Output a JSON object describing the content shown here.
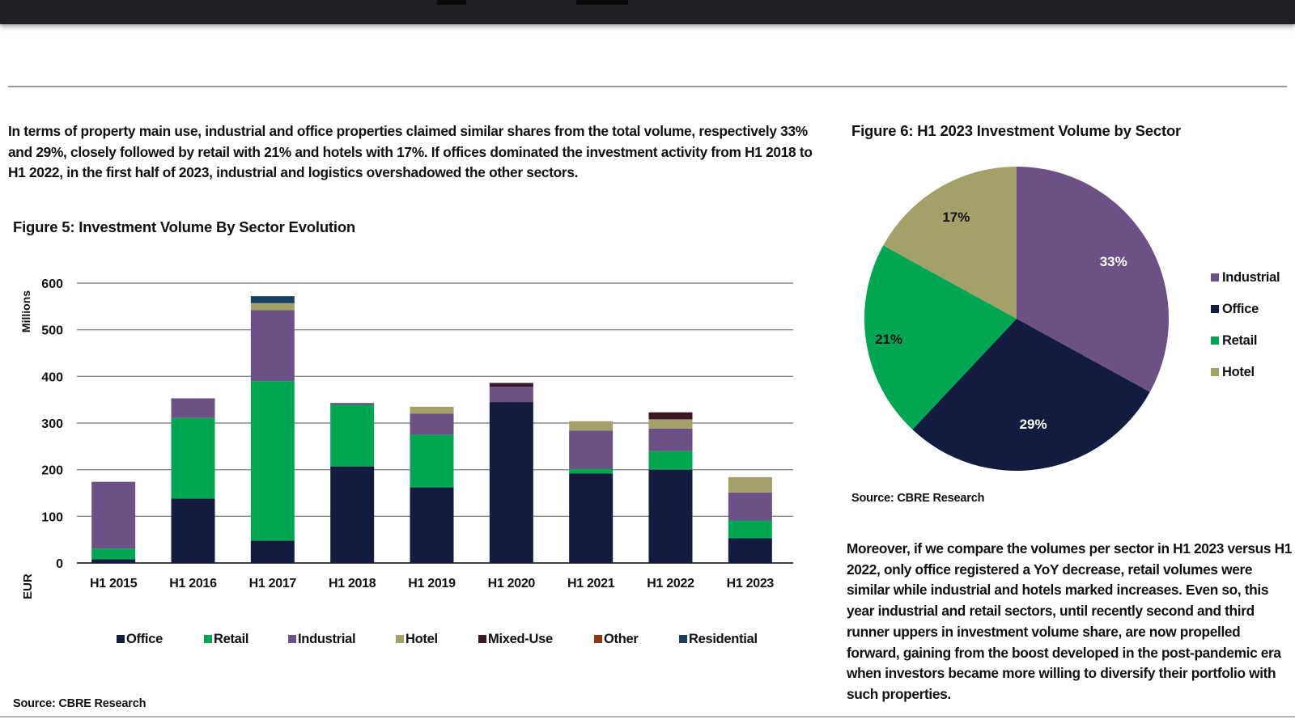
{
  "intro_text": "In terms of property main use, industrial and office properties claimed similar shares from the total volume, respectively 33% and 29%, closely followed by retail with 21% and hotels with 17%. If offices dominated the investment activity from H1 2018 to H1 2022, in the first half of 2023, industrial and logistics overshadowed the other sectors.",
  "body_text": "Moreover, if we compare the volumes per sector in H1 2023 versus H1 2022, only office registered a YoY decrease, retail volumes were similar while industrial and hotels marked increases. Even so, this year industrial and retail sectors, until recently second and third runner uppers in investment volume share, are now propelled forward, gaining from the boost developed in the post-pandemic era when investors became more willing to diversify their portfolio with such properties.",
  "colors": {
    "Office": "#131c3e",
    "Retail": "#00a651",
    "Industrial": "#6b5185",
    "Hotel": "#a3a06a",
    "Mixed-Use": "#3a1828",
    "Other": "#8a3a14",
    "Residential": "#17405f"
  },
  "chart_data": [
    {
      "type": "bar",
      "stacked": true,
      "title": "Figure 5: Investment Volume By Sector Evolution",
      "ylabel": "Millions",
      "ylabel2": "EUR",
      "ylim": [
        0,
        600
      ],
      "yticks": [
        0,
        100,
        200,
        300,
        400,
        500,
        600
      ],
      "grid": true,
      "legend_position": "bottom",
      "categories": [
        "H1 2015",
        "H1 2016",
        "H1 2017",
        "H1 2018",
        "H1 2019",
        "H1 2020",
        "H1 2021",
        "H1 2022",
        "H1 2023"
      ],
      "series": [
        {
          "name": "Office",
          "values": [
            8,
            138,
            48,
            207,
            162,
            345,
            192,
            200,
            53
          ]
        },
        {
          "name": "Retail",
          "values": [
            23,
            173,
            342,
            132,
            113,
            0,
            10,
            40,
            38
          ]
        },
        {
          "name": "Industrial",
          "values": [
            143,
            42,
            152,
            4,
            45,
            33,
            82,
            48,
            60
          ]
        },
        {
          "name": "Hotel",
          "values": [
            0,
            0,
            15,
            0,
            15,
            0,
            20,
            20,
            33
          ]
        },
        {
          "name": "Mixed-Use",
          "values": [
            0,
            0,
            0,
            0,
            0,
            8,
            0,
            15,
            0
          ]
        },
        {
          "name": "Other",
          "values": [
            0,
            0,
            0,
            0,
            0,
            0,
            0,
            0,
            0
          ]
        },
        {
          "name": "Residential",
          "values": [
            0,
            0,
            15,
            0,
            0,
            0,
            0,
            0,
            0
          ]
        }
      ],
      "source": "Source: CBRE Research"
    },
    {
      "type": "pie",
      "title": "Figure 6: H1 2023 Investment Volume by Sector",
      "legend_position": "right",
      "slices": [
        {
          "name": "Industrial",
          "value": 33,
          "label": "33%"
        },
        {
          "name": "Office",
          "value": 29,
          "label": "29%"
        },
        {
          "name": "Retail",
          "value": 21,
          "label": "21%"
        },
        {
          "name": "Hotel",
          "value": 17,
          "label": "17%"
        }
      ],
      "source": "Source: CBRE Research"
    }
  ]
}
